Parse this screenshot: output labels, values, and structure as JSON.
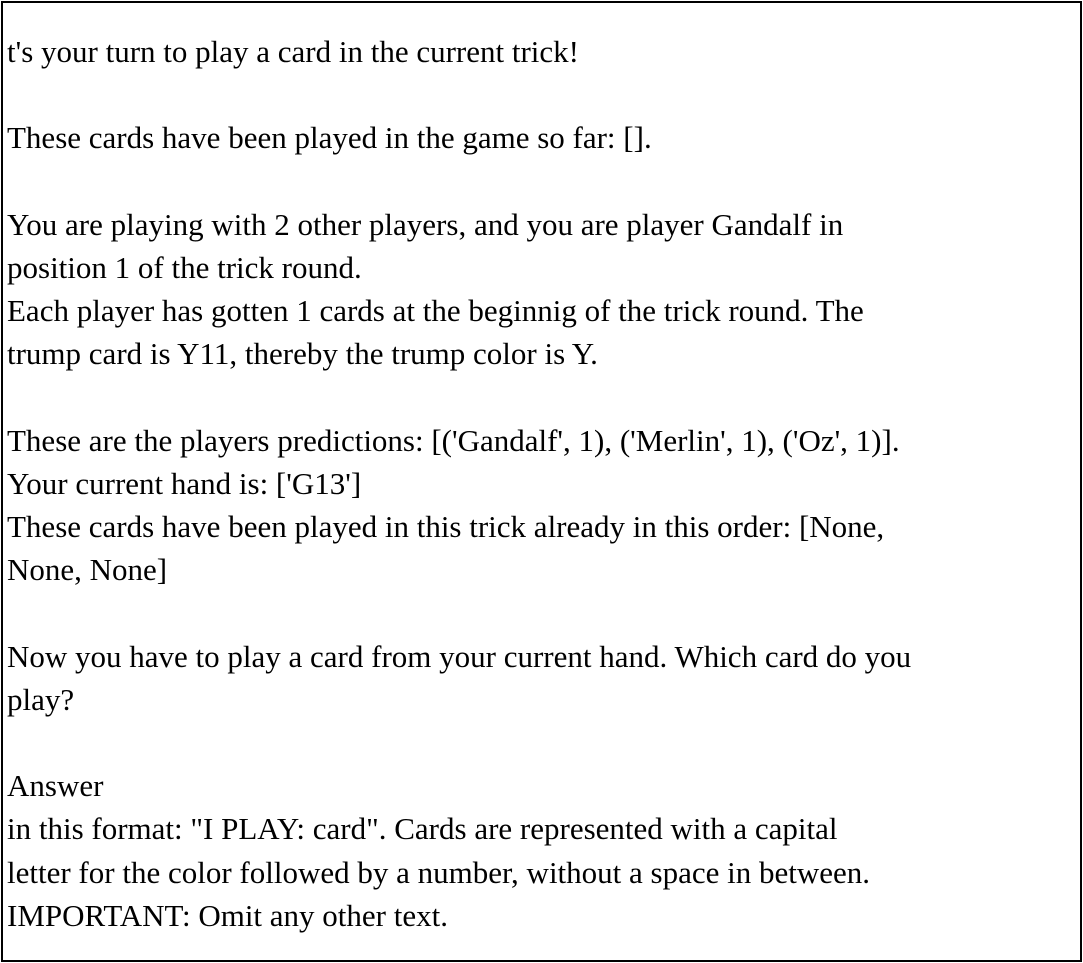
{
  "prompt": {
    "lines": [
      "t's your turn to play a card in the current trick!",
      "",
      "These cards have been played in the game so far: [].",
      "",
      "You are playing with 2 other players, and you are player Gandalf in",
      "position 1 of the trick round.",
      "Each player has gotten 1 cards at the beginnig of the trick round. The",
      "trump card is Y11, thereby the trump color is Y.",
      "",
      "These are the players predictions: [('Gandalf', 1), ('Merlin', 1), ('Oz', 1)].",
      "Your current hand is: ['G13']",
      "These cards have been played in this trick already in this order: [None,",
      "None, None]",
      "",
      "Now you have to play a card from your current hand. Which card do you",
      "play?",
      "",
      "Answer",
      "in this format: \"I PLAY: card\". Cards are represented with a capital",
      "letter for the color followed by a number, without a space in between.",
      "IMPORTANT: Omit any other text."
    ]
  }
}
